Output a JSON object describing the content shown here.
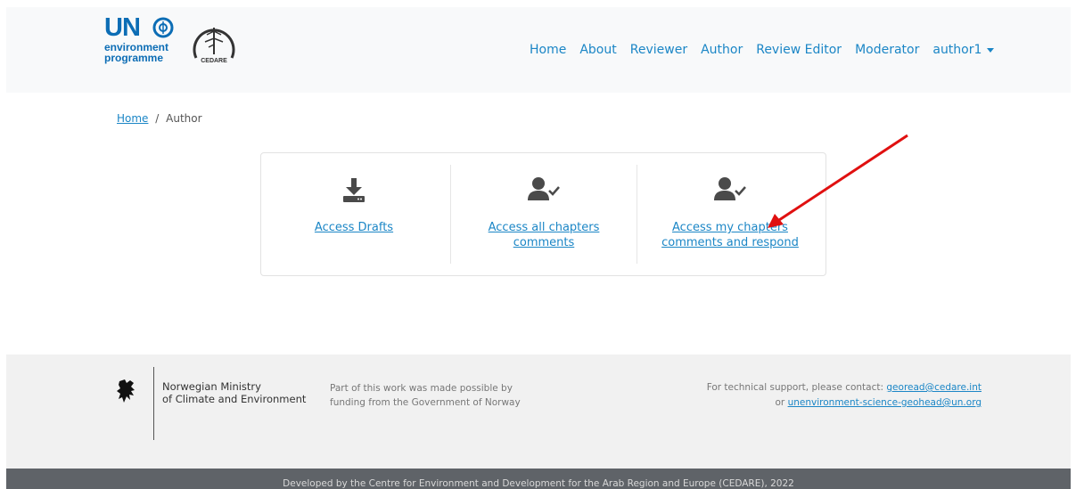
{
  "header": {
    "logo_un_text": "UN",
    "logo_un_line1": "environment",
    "logo_un_line2": "programme",
    "logo_cedare_text": "CEDARE",
    "nav": [
      {
        "label": "Home"
      },
      {
        "label": "About"
      },
      {
        "label": "Reviewer"
      },
      {
        "label": "Author"
      },
      {
        "label": "Review Editor"
      },
      {
        "label": "Moderator"
      },
      {
        "label": "author1"
      }
    ]
  },
  "breadcrumb": {
    "home": "Home",
    "separator": "/",
    "current": "Author"
  },
  "actions": [
    {
      "line1": "Access Drafts",
      "line2": "",
      "icon": "download-icon"
    },
    {
      "line1": "Access all chapters",
      "line2": "comments",
      "icon": "user-check-icon"
    },
    {
      "line1": "Access my chapters",
      "line2": "comments and respond",
      "icon": "user-check-icon"
    }
  ],
  "footer": {
    "ministry_line1": "Norwegian Ministry",
    "ministry_line2": "of Climate and Environment",
    "funding_line1": "Part of this work was made possible by",
    "funding_line2": "funding from the Government of Norway",
    "support_prefix": "For technical support, please contact:",
    "support_email1": "georead@cedare.int",
    "support_or": "or",
    "support_email2": "unenvironment-science-geohead@un.org",
    "credit": "Developed by the Centre for Environment and Development for the Arab Region and Europe (CEDARE), 2022"
  },
  "colors": {
    "link": "#1b86c6",
    "un_blue": "#0c6db5",
    "annotation_arrow": "#e01010",
    "footer_bar": "#5f6368"
  }
}
